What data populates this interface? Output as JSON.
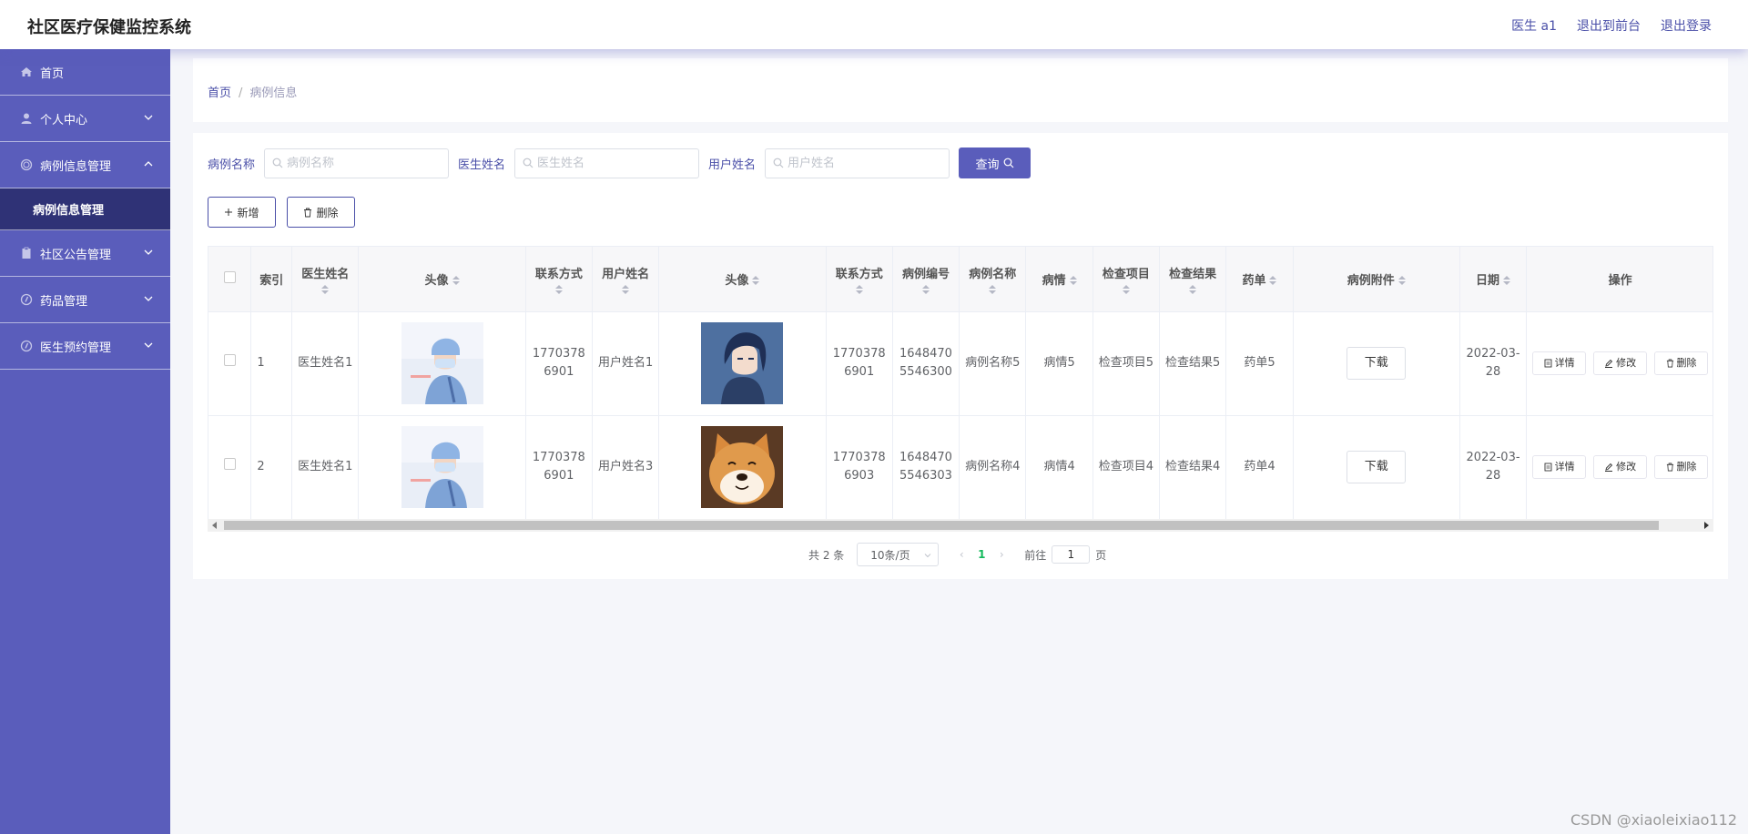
{
  "app": {
    "title": "社区医疗保健监控系统"
  },
  "top_links": {
    "user": "医生 a1",
    "front": "退出到前台",
    "logout": "退出登录"
  },
  "sidebar": {
    "items": [
      {
        "label": "首页",
        "icon": "home-icon"
      },
      {
        "label": "个人中心",
        "icon": "user-icon"
      },
      {
        "label": "病例信息管理",
        "icon": "circle-icon"
      },
      {
        "label": "病例信息管理",
        "icon": ""
      },
      {
        "label": "社区公告管理",
        "icon": "clipboard-icon"
      },
      {
        "label": "药品管理",
        "icon": "compass-icon"
      },
      {
        "label": "医生预约管理",
        "icon": "compass-icon"
      }
    ]
  },
  "breadcrumb": {
    "home": "首页",
    "sep": "/",
    "current": "病例信息"
  },
  "search": {
    "name_label": "病例名称",
    "name_placeholder": "病例名称",
    "doctor_label": "医生姓名",
    "doctor_placeholder": "医生姓名",
    "user_label": "用户姓名",
    "user_placeholder": "用户姓名",
    "query_label": "查询"
  },
  "actions": {
    "add_label": "新增",
    "delete_label": "删除"
  },
  "table": {
    "headers": [
      "索引",
      "医生姓名",
      "头像",
      "联系方式",
      "用户姓名",
      "头像",
      "联系方式",
      "病例编号",
      "病例名称",
      "病情",
      "检查项目",
      "检查结果",
      "药单",
      "病例附件",
      "日期",
      "操作"
    ],
    "rows": [
      {
        "index": "1",
        "doctor_name": "医生姓名1",
        "doctor_phone": "17703786901",
        "user_name": "用户姓名1",
        "user_phone": "17703786901",
        "case_no": "16484705546300",
        "case_name": "病例名称5",
        "condition": "病情5",
        "exam_item": "检查项目5",
        "exam_result": "检查结果5",
        "prescription": "药单5",
        "attachment_label": "下载",
        "date": "2022-03-28",
        "user_avatar": "anime-avatar"
      },
      {
        "index": "2",
        "doctor_name": "医生姓名1",
        "doctor_phone": "17703786901",
        "user_name": "用户姓名3",
        "user_phone": "17703786903",
        "case_no": "16484705546303",
        "case_name": "病例名称4",
        "condition": "病情4",
        "exam_item": "检查项目4",
        "exam_result": "检查结果4",
        "prescription": "药单4",
        "attachment_label": "下载",
        "date": "2022-03-28",
        "user_avatar": "shiba-dog-avatar"
      }
    ],
    "ops": {
      "detail": "详情",
      "edit": "修改",
      "delete": "删除"
    }
  },
  "pagination": {
    "total": "共 2 条",
    "page_size": "10条/页",
    "current_page": "1",
    "goto_prefix": "前往",
    "goto_value": "1",
    "goto_suffix": "页"
  },
  "watermark": "CSDN @xiaoleixiao112",
  "colors": {
    "sidebar": "#5a5dbb",
    "submenu": "#2f3276",
    "accent": "#4a4fa8",
    "page_active": "#13b95c"
  }
}
